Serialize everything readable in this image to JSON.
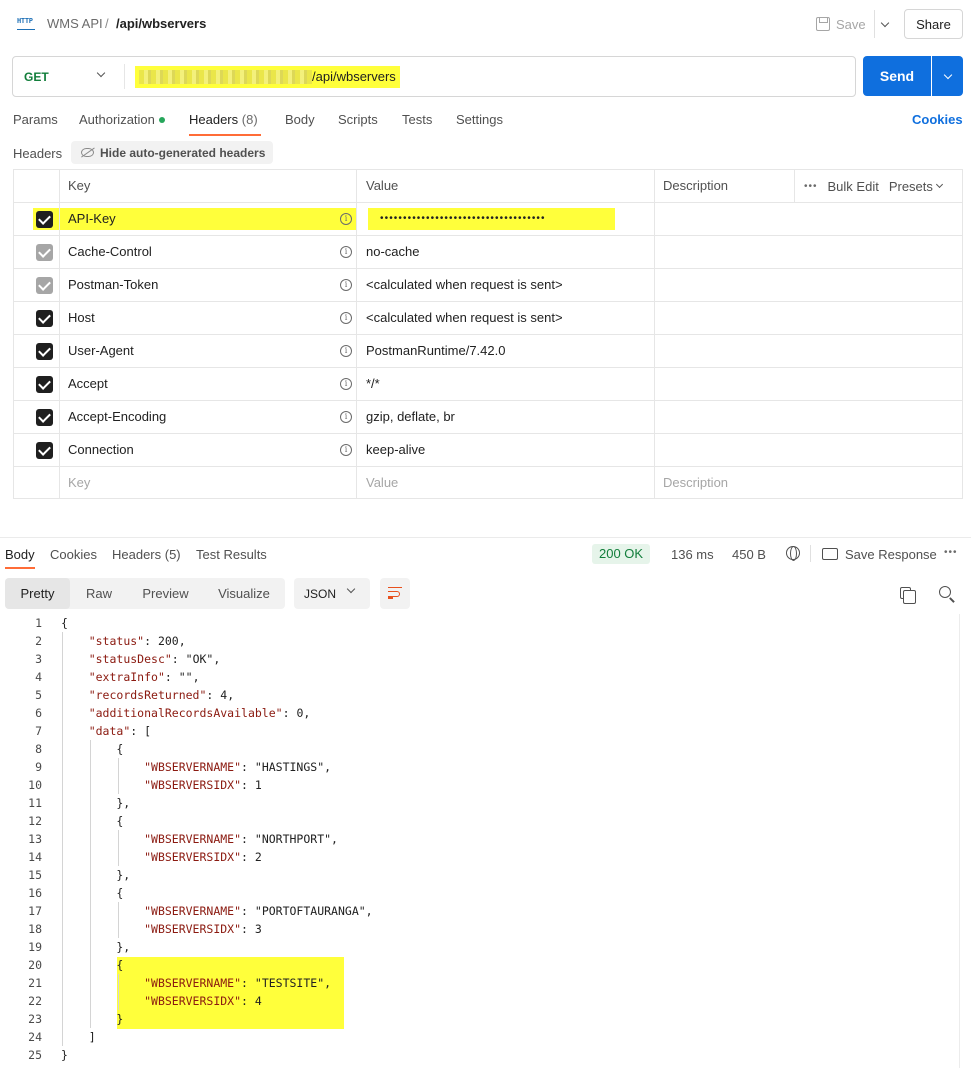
{
  "topbar": {
    "http_icon": "HTTP",
    "breadcrumb_root": "WMS API",
    "breadcrumb_sep": "/",
    "breadcrumb_current": "/api/wbservers",
    "save_label": "Save",
    "share_label": "Share"
  },
  "request": {
    "method": "GET",
    "url_visible": "/api/wbservers",
    "send_label": "Send"
  },
  "request_tabs": [
    {
      "label": "Params"
    },
    {
      "label": "Authorization"
    },
    {
      "label": "Headers",
      "count": "(8)"
    },
    {
      "label": "Body"
    },
    {
      "label": "Scripts"
    },
    {
      "label": "Tests"
    },
    {
      "label": "Settings"
    }
  ],
  "cookies_label": "Cookies",
  "headers_section": {
    "title": "Headers",
    "hide_auto_label": "Hide auto-generated headers",
    "columns": {
      "key": "Key",
      "value": "Value",
      "description": "Description"
    },
    "bulk_edit_label": "Bulk Edit",
    "presets_label": "Presets",
    "rows": [
      {
        "key": "API-Key",
        "value": "••••••••••••••••••••••••••••••••••••",
        "checked": true,
        "auto": false
      },
      {
        "key": "Cache-Control",
        "value": "no-cache",
        "checked": true,
        "auto": true
      },
      {
        "key": "Postman-Token",
        "value": "<calculated when request is sent>",
        "checked": true,
        "auto": true
      },
      {
        "key": "Host",
        "value": "<calculated when request is sent>",
        "checked": true,
        "auto": false
      },
      {
        "key": "User-Agent",
        "value": "PostmanRuntime/7.42.0",
        "checked": true,
        "auto": false
      },
      {
        "key": "Accept",
        "value": "*/*",
        "checked": true,
        "auto": false
      },
      {
        "key": "Accept-Encoding",
        "value": "gzip, deflate, br",
        "checked": true,
        "auto": false
      },
      {
        "key": "Connection",
        "value": "keep-alive",
        "checked": true,
        "auto": false
      }
    ],
    "placeholder": {
      "key": "Key",
      "value": "Value",
      "description": "Description"
    }
  },
  "response": {
    "tabs": [
      {
        "label": "Body"
      },
      {
        "label": "Cookies"
      },
      {
        "label": "Headers (5)"
      },
      {
        "label": "Test Results"
      }
    ],
    "status": "200 OK",
    "time": "136 ms",
    "size": "450 B",
    "save_response_label": "Save Response",
    "views": [
      "Pretty",
      "Raw",
      "Preview",
      "Visualize"
    ],
    "format": "JSON"
  },
  "code_lines": [
    {
      "n": "1",
      "t": "{"
    },
    {
      "n": "2",
      "t": "    \"status\": 200,"
    },
    {
      "n": "3",
      "t": "    \"statusDesc\": \"OK\","
    },
    {
      "n": "4",
      "t": "    \"extraInfo\": \"\","
    },
    {
      "n": "5",
      "t": "    \"recordsReturned\": 4,"
    },
    {
      "n": "6",
      "t": "    \"additionalRecordsAvailable\": 0,"
    },
    {
      "n": "7",
      "t": "    \"data\": ["
    },
    {
      "n": "8",
      "t": "        {"
    },
    {
      "n": "9",
      "t": "            \"WBSERVERNAME\": \"HASTINGS\","
    },
    {
      "n": "10",
      "t": "            \"WBSERVERSIDX\": 1"
    },
    {
      "n": "11",
      "t": "        },"
    },
    {
      "n": "12",
      "t": "        {"
    },
    {
      "n": "13",
      "t": "            \"WBSERVERNAME\": \"NORTHPORT\","
    },
    {
      "n": "14",
      "t": "            \"WBSERVERSIDX\": 2"
    },
    {
      "n": "15",
      "t": "        },"
    },
    {
      "n": "16",
      "t": "        {"
    },
    {
      "n": "17",
      "t": "            \"WBSERVERNAME\": \"PORTOFTAURANGA\","
    },
    {
      "n": "18",
      "t": "            \"WBSERVERSIDX\": 3"
    },
    {
      "n": "19",
      "t": "        },"
    },
    {
      "n": "20",
      "t": "        {"
    },
    {
      "n": "21",
      "t": "            \"WBSERVERNAME\": \"TESTSITE\","
    },
    {
      "n": "22",
      "t": "            \"WBSERVERSIDX\": 4"
    },
    {
      "n": "23",
      "t": "        }"
    },
    {
      "n": "24",
      "t": "    ]"
    },
    {
      "n": "25",
      "t": "}"
    }
  ],
  "colors": {
    "accent": "#ff6c37",
    "send": "#0f6fde",
    "highlight": "#ffff3b",
    "method": "#127e3b"
  }
}
